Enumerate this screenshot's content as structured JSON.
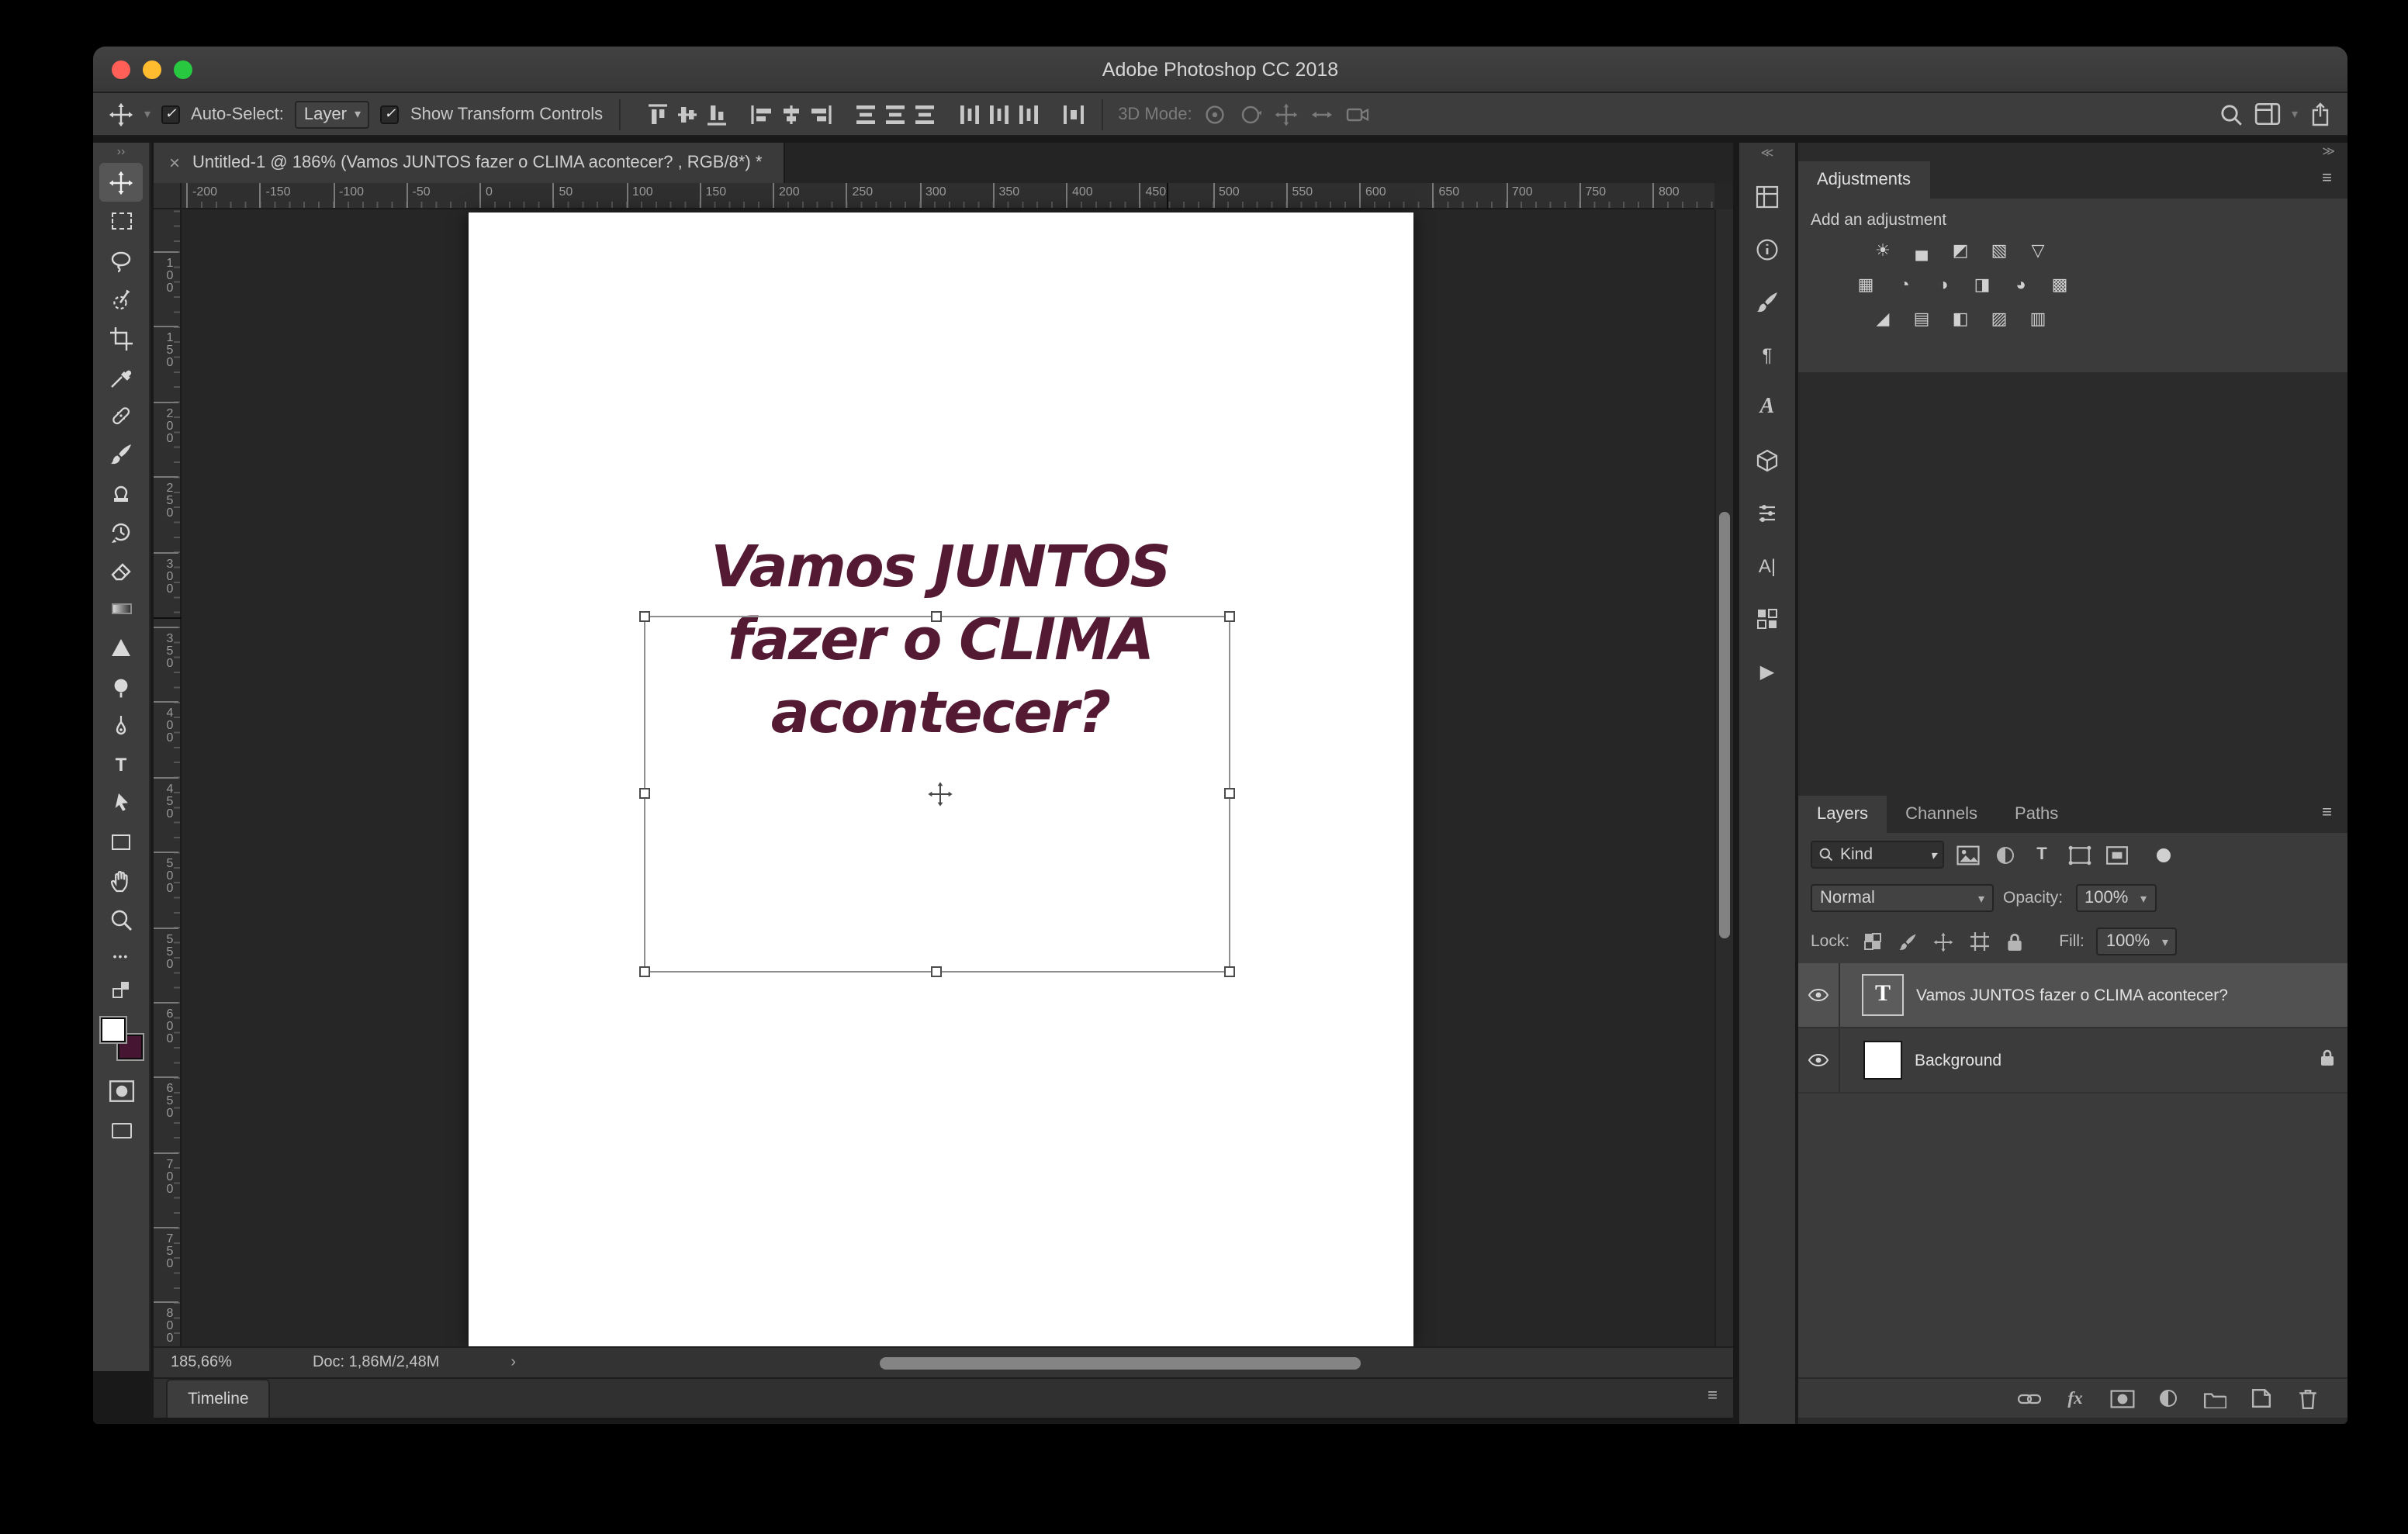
{
  "titlebar": {
    "title": "Adobe Photoshop CC 2018"
  },
  "glyphs": {
    "check": "✓",
    "chevron_down": "▾",
    "chevron_right": "›",
    "dbl_chevron_left": "≪",
    "dbl_chevron_right": "≫",
    "toolbar_collapse": "››",
    "menu": "≡",
    "ellipsis_tool": "•••",
    "T": "T",
    "fx": "fx",
    "paragraph": "¶",
    "char_a": "A",
    "glyphs_tool": "A|",
    "play": "▶",
    "info_i": "i"
  },
  "options": {
    "auto_select": "Auto-Select:",
    "auto_select_value": "Layer",
    "show_transform": "Show Transform Controls",
    "mode_3d": "3D Mode:"
  },
  "tab": {
    "close": "×",
    "title": "Untitled-1 @ 186% (Vamos JUNTOS fazer o CLIMA acontecer? , RGB/8*) *"
  },
  "ruler_h": [
    "-200",
    "-150",
    "-100",
    "-50",
    "0",
    "50",
    "100",
    "150",
    "200",
    "250",
    "300",
    "350",
    "400",
    "450",
    "500",
    "550",
    "600",
    "650",
    "700",
    "750",
    "800"
  ],
  "ruler_v": [
    "100",
    "150",
    "200",
    "250",
    "300",
    "350",
    "400",
    "450",
    "500",
    "550",
    "600",
    "650",
    "700",
    "750",
    "800"
  ],
  "canvas_text": {
    "line1": "Vamos JUNTOS",
    "line2": "fazer o CLIMA",
    "line3": "acontecer?",
    "color": "#551a33"
  },
  "status": {
    "zoom": "185,66%",
    "doc_size": "Doc: 1,86M/2,48M"
  },
  "timeline": {
    "label": "Timeline"
  },
  "adjustments": {
    "tab": "Adjustments",
    "heading": "Add an adjustment",
    "row1": [
      "☀",
      "▄",
      "◩",
      "▧",
      "▽"
    ],
    "row2": [
      "▦",
      "◔",
      "◑",
      "◨",
      "◕",
      "▩"
    ],
    "row3": [
      "◢",
      "▤",
      "◧",
      "▨",
      "▥"
    ]
  },
  "layers": {
    "tabs": [
      "Layers",
      "Channels",
      "Paths"
    ],
    "kind": "Kind",
    "blend": "Normal",
    "opacity_label": "Opacity:",
    "opacity": "100%",
    "lock_label": "Lock:",
    "fill_label": "Fill:",
    "fill": "100%",
    "rows": [
      {
        "name": "Vamos JUNTOS fazer o CLIMA acontecer?"
      },
      {
        "name": "Background"
      }
    ]
  },
  "colors": {
    "foreground": "#ffffff",
    "background_swatch": "#451532",
    "canvas_text": "#551a33"
  }
}
